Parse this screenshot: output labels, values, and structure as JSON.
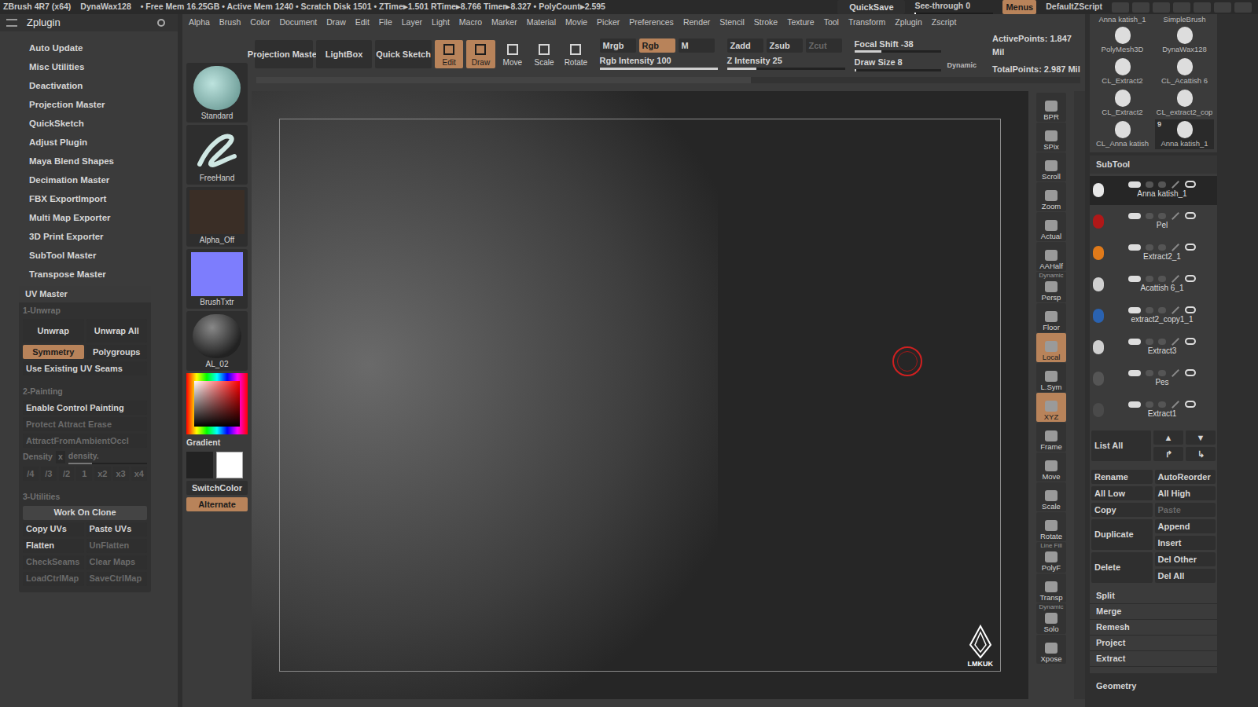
{
  "title_bar": {
    "app": "ZBrush 4R7 (x64)",
    "tool": "DynaWax128",
    "stats": "• Free Mem 16.25GB • Active Mem 1240 • Scratch Disk 1501 • ZTime▸1.501 RTime▸8.766 Timer▸8.327 • PolyCount▸2.595",
    "quicksave": "QuickSave",
    "see_through": {
      "label": "See-through",
      "value": "0",
      "level": 0.0
    },
    "menus_button": {
      "label": "Menus",
      "selected": true
    },
    "script": "DefaultZScript"
  },
  "menus": [
    "Alpha",
    "Brush",
    "Color",
    "Document",
    "Draw",
    "Edit",
    "File",
    "Layer",
    "Light",
    "Macro",
    "Marker",
    "Material",
    "Movie",
    "Picker",
    "Preferences",
    "Render",
    "Stencil",
    "Stroke",
    "Texture",
    "Tool",
    "Transform",
    "Zplugin",
    "Zscript"
  ],
  "left_panel": {
    "title": "Zplugin",
    "items": [
      "Auto Update",
      "Misc Utilities",
      "Deactivation",
      "Projection Master",
      "QuickSketch",
      "Adjust Plugin",
      "Maya Blend Shapes",
      "Decimation Master",
      "FBX ExportImport",
      "Multi Map Exporter",
      "3D Print Exporter",
      "SubTool Master",
      "Transpose Master"
    ],
    "uv_master": {
      "title": "UV Master",
      "unwrap_section": "1-Unwrap",
      "unwrap_buttons": [
        {
          "label": "Unwrap",
          "selected": false
        },
        {
          "label": "Unwrap All",
          "selected": false
        }
      ],
      "toggles": [
        {
          "label": "Symmetry",
          "selected": true
        },
        {
          "label": "Polygroups",
          "selected": false
        }
      ],
      "use_seams": "Use Existing UV Seams",
      "painting_section": "2-Painting",
      "painting_buttons": [
        {
          "label": "Enable Control Painting",
          "disabled": false
        },
        {
          "label": "Protect Attract Erase",
          "disabled": true
        },
        {
          "label": "AttractFromAmbientOccl",
          "disabled": true
        }
      ],
      "density": {
        "label": "Density",
        "x": "x",
        "slider": "density.",
        "level": 0.3
      },
      "density_buttons": [
        "/4",
        "/3",
        "/2",
        "1",
        "x2",
        "x3",
        "x4"
      ],
      "utilities_section": "3-Utilities",
      "work_on_clone": "Work On Clone",
      "utility_buttons": [
        {
          "label": "Copy UVs",
          "disabled": false
        },
        {
          "label": "Paste UVs",
          "disabled": false
        },
        {
          "label": "Flatten",
          "disabled": false
        },
        {
          "label": "UnFlatten",
          "disabled": true
        },
        {
          "label": "CheckSeams",
          "disabled": true
        },
        {
          "label": "Clear Maps",
          "disabled": true
        },
        {
          "label": "LoadCtrlMap",
          "disabled": true
        },
        {
          "label": "SaveCtrlMap",
          "disabled": true
        }
      ]
    }
  },
  "shelf": {
    "brush": "Standard",
    "stroke": "FreeHand",
    "alpha": "Alpha_Off",
    "texture": "BrushTxtr",
    "material": "AL_02",
    "gradient": "Gradient",
    "switch_color": "SwitchColor",
    "alternate": "Alternate"
  },
  "toolbar": {
    "projection_master": "Projection Master",
    "lightbox": "LightBox",
    "quick_sketch": "Quick Sketch",
    "modes": [
      {
        "label": "Edit",
        "selected": true
      },
      {
        "label": "Draw",
        "selected": true
      },
      {
        "label": "Move",
        "selected": false
      },
      {
        "label": "Scale",
        "selected": false
      },
      {
        "label": "Rotate",
        "selected": false
      }
    ],
    "rgb_modes": [
      {
        "label": "Mrgb",
        "selected": false
      },
      {
        "label": "Rgb",
        "selected": true
      },
      {
        "label": "M",
        "selected": false
      }
    ],
    "rgb_intensity": {
      "label": "Rgb Intensity",
      "value": "100",
      "level": 1.0
    },
    "z_modes": [
      {
        "label": "Zadd",
        "selected": false,
        "disabled": false
      },
      {
        "label": "Zsub",
        "selected": false,
        "disabled": false
      },
      {
        "label": "Zcut",
        "selected": false,
        "disabled": true
      }
    ],
    "z_intensity": {
      "label": "Z Intensity",
      "value": "25",
      "level": 0.25
    },
    "focal_shift": {
      "label": "Focal Shift",
      "value": "-38",
      "level": 0.31
    },
    "draw_size": {
      "label": "Draw Size",
      "value": "8",
      "level": 0.02
    },
    "dynamic": "Dynamic",
    "active_points": "ActivePoints: 1.847 Mil",
    "total_points": "TotalPoints: 2.987 Mil"
  },
  "canvas": {
    "watermark": "LMKUK"
  },
  "right_shelf": [
    {
      "label": "BPR",
      "selected": false
    },
    {
      "label": "SPix",
      "selected": false
    },
    {
      "label": "Scroll",
      "selected": false
    },
    {
      "label": "Zoom",
      "selected": false
    },
    {
      "label": "Actual",
      "selected": false
    },
    {
      "label": "AAHalf",
      "selected": false
    },
    {
      "label": "Persp",
      "selected": false,
      "note": "Dynamic"
    },
    {
      "label": "Floor",
      "selected": false
    },
    {
      "label": "Local",
      "selected": true
    },
    {
      "label": "L.Sym",
      "selected": false
    },
    {
      "label": "XYZ",
      "selected": true
    },
    {
      "label": "Frame",
      "selected": false
    },
    {
      "label": "Move",
      "selected": false
    },
    {
      "label": "Scale",
      "selected": false
    },
    {
      "label": "Rotate",
      "selected": false
    },
    {
      "label": "PolyF",
      "selected": false,
      "note": "Line Fill"
    },
    {
      "label": "Transp",
      "selected": false
    },
    {
      "label": "Solo",
      "selected": false,
      "note": "Dynamic"
    },
    {
      "label": "Xpose",
      "selected": false
    }
  ],
  "tool_palette": {
    "top": [
      "Anna katish_1",
      "SimpleBrush"
    ],
    "tools": [
      {
        "label": "PolyMesh3D",
        "badge": ""
      },
      {
        "label": "DynaWax128",
        "badge": ""
      },
      {
        "label": "CL_Extract2",
        "badge": ""
      },
      {
        "label": "CL_Acattish 6",
        "badge": ""
      },
      {
        "label": "CL_Extract2",
        "badge": ""
      },
      {
        "label": "CL_extract2_cop",
        "badge": ""
      },
      {
        "label": "CL_Anna katish",
        "badge": ""
      },
      {
        "label": "Anna katish_1",
        "badge": "9"
      }
    ]
  },
  "subtool": {
    "title": "SubTool",
    "items": [
      {
        "name": "Anna katish_1",
        "selected": true,
        "color": "#e8e8e8"
      },
      {
        "name": "Pel",
        "selected": false,
        "color": "#b01818"
      },
      {
        "name": "Extract2_1",
        "selected": false,
        "color": "#e07a1a"
      },
      {
        "name": "Acattish 6_1",
        "selected": false,
        "color": "#d0d0d0"
      },
      {
        "name": "extract2_copy1_1",
        "selected": false,
        "color": "#2a62b0"
      },
      {
        "name": "Extract3",
        "selected": false,
        "color": "#cfcfcf"
      },
      {
        "name": "Pes",
        "selected": false,
        "color": "#555555"
      },
      {
        "name": "Extract1",
        "selected": false,
        "color": "#4a4a4a"
      }
    ],
    "list_all": "List All",
    "arrows": [
      "▲",
      "▼",
      "↱",
      "↳"
    ],
    "button_rows": [
      [
        {
          "label": "Rename",
          "disabled": false
        },
        {
          "label": "AutoReorder",
          "disabled": false
        }
      ],
      [
        {
          "label": "All Low",
          "disabled": false
        },
        {
          "label": "All High",
          "disabled": false
        }
      ],
      [
        {
          "label": "Copy",
          "disabled": false
        },
        {
          "label": "Paste",
          "disabled": true
        }
      ]
    ],
    "duplicate": "Duplicate",
    "append": "Append",
    "insert": "Insert",
    "delete": "Delete",
    "del_other": "Del Other",
    "del_all": "Del All",
    "sections": [
      "Split",
      "Merge",
      "Remesh",
      "Project",
      "Extract"
    ],
    "geometry": "Geometry"
  }
}
